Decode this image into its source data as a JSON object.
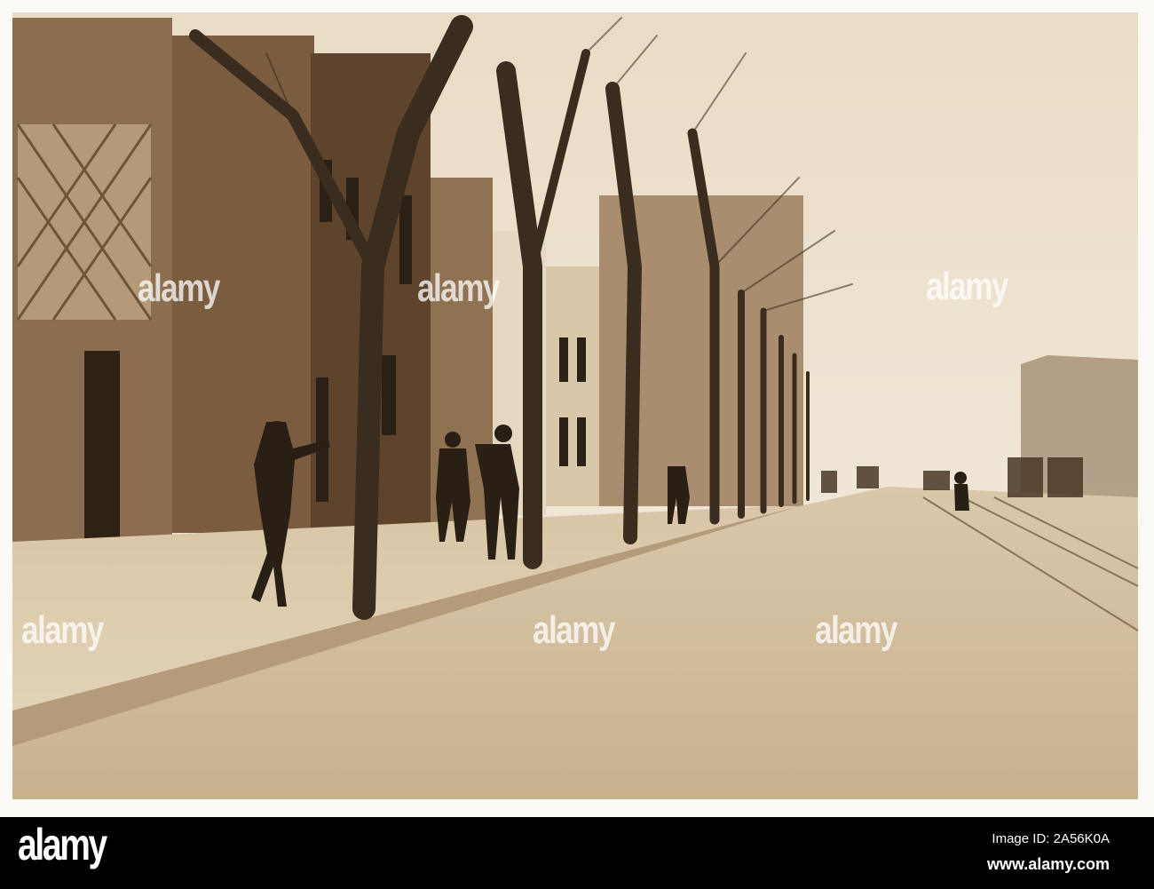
{
  "watermark": {
    "text": "alamy"
  },
  "footer": {
    "logo": "alamy",
    "image_id": "Image ID: 2A56K0A",
    "website": "www.alamy.com"
  }
}
